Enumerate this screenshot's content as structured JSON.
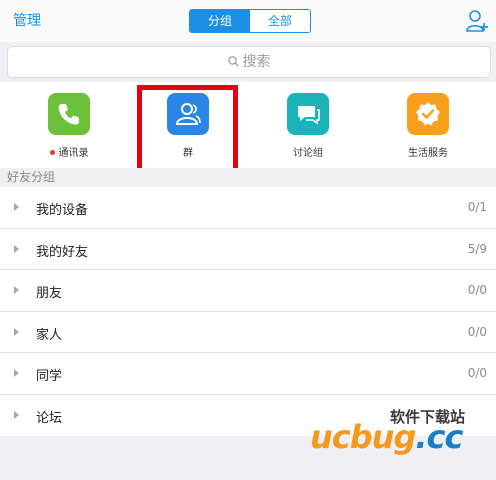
{
  "topbar": {
    "manage_label": "管理",
    "segments": [
      "分组",
      "全部"
    ],
    "active_segment": "分组",
    "add_friend_icon": "add-user-icon",
    "accent_color": "#1a8fe3"
  },
  "search": {
    "placeholder": "搜索",
    "icon": "search-icon"
  },
  "quick_entries": [
    {
      "label": "通讯录",
      "icon": "phone-icon",
      "color": "#6cc03a",
      "badge_dot": true
    },
    {
      "label": "群",
      "icon": "group-icon",
      "color": "#2a86e6",
      "highlighted": true
    },
    {
      "label": "讨论组",
      "icon": "chat-bubble-icon",
      "color": "#1ab4b8"
    },
    {
      "label": "生活服务",
      "icon": "badge-check-icon",
      "color": "#f8a01c"
    }
  ],
  "friends": {
    "section_title": "好友分组",
    "groups": [
      {
        "name": "我的设备",
        "count": "0/1"
      },
      {
        "name": "我的好友",
        "count": "5/9"
      },
      {
        "name": "朋友",
        "count": "0/0"
      },
      {
        "name": "家人",
        "count": "0/0"
      },
      {
        "name": "同学",
        "count": "0/0"
      },
      {
        "name": "论坛",
        "count": ""
      }
    ]
  },
  "watermark": {
    "top_text": "软件下载站",
    "brand_a": "ucbug",
    "brand_b": ".cc"
  }
}
